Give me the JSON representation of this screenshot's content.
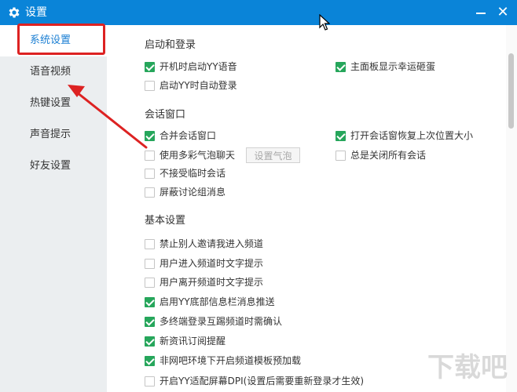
{
  "window": {
    "title": "设置",
    "minimize_icon": "minimize-icon",
    "close_icon": "close-icon",
    "title_color": "#0a84d8"
  },
  "sidebar": {
    "items": [
      {
        "label": "系统设置",
        "active": true
      },
      {
        "label": "语音视频",
        "active": false
      },
      {
        "label": "热键设置",
        "active": false
      },
      {
        "label": "声音提示",
        "active": false
      },
      {
        "label": "好友设置",
        "active": false
      }
    ]
  },
  "sections": {
    "startup": {
      "title": "启动和登录",
      "options": [
        {
          "label": "开机时启动YY语音",
          "checked": true
        },
        {
          "label": "主面板显示幸运砸蛋",
          "checked": true
        },
        {
          "label": "启动YY时自动登录",
          "checked": false
        }
      ]
    },
    "session": {
      "title": "会话窗口",
      "options": [
        {
          "label": "合并会话窗口",
          "checked": true
        },
        {
          "label": "打开会话窗恢复上次位置大小",
          "checked": true
        },
        {
          "label": "使用多彩气泡聊天",
          "checked": false
        },
        {
          "label": "总是关闭所有会话",
          "checked": false
        },
        {
          "label": "不接受临时会话",
          "checked": false
        },
        {
          "label": "屏蔽讨论组消息",
          "checked": false
        }
      ],
      "bubble_button": "设置气泡"
    },
    "basic": {
      "title": "基本设置",
      "options": [
        {
          "label": "禁止别人邀请我进入频道",
          "checked": false
        },
        {
          "label": "用户进入频道时文字提示",
          "checked": false
        },
        {
          "label": "用户离开频道时文字提示",
          "checked": false
        },
        {
          "label": "启用YY底部信息栏消息推送",
          "checked": true
        },
        {
          "label": "多终端登录互踢频道时需确认",
          "checked": true
        },
        {
          "label": "新资讯订阅提醒",
          "checked": true
        },
        {
          "label": "非网吧环境下开启频道模板预加载",
          "checked": true
        },
        {
          "label": "开启YY适配屏幕DPI(设置后需要重新登录才生效)",
          "checked": false
        }
      ]
    }
  },
  "annotation": {
    "color": "#dd2222"
  },
  "watermark": {
    "text": "下载吧"
  }
}
